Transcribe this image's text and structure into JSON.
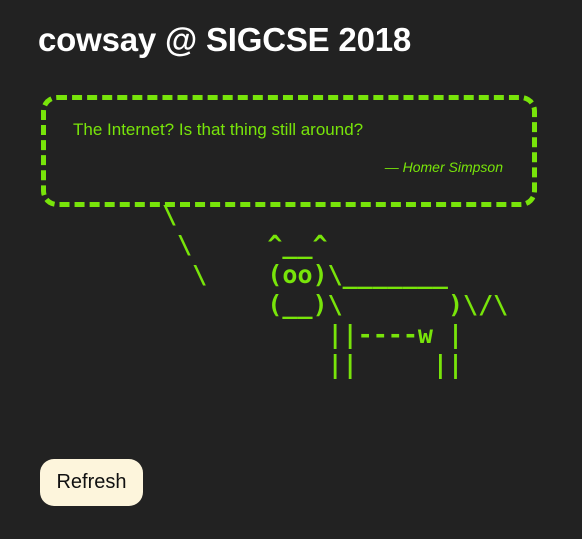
{
  "page": {
    "title": "cowsay @ SIGCSE 2018"
  },
  "quote": {
    "text": "The Internet? Is that thing still around?",
    "attribution": "— Homer Simpson"
  },
  "cow": {
    "ascii": "\\\n \\     ^__^\n  \\    (oo)\\_______\n       (__)\\       )\\/\\\n           ||----w |\n           ||     ||"
  },
  "controls": {
    "refresh_label": "Refresh"
  },
  "colors": {
    "background": "#222222",
    "accent_green": "#78e40a",
    "title_text": "#ffffff",
    "button_bg": "#fdf5dc"
  }
}
